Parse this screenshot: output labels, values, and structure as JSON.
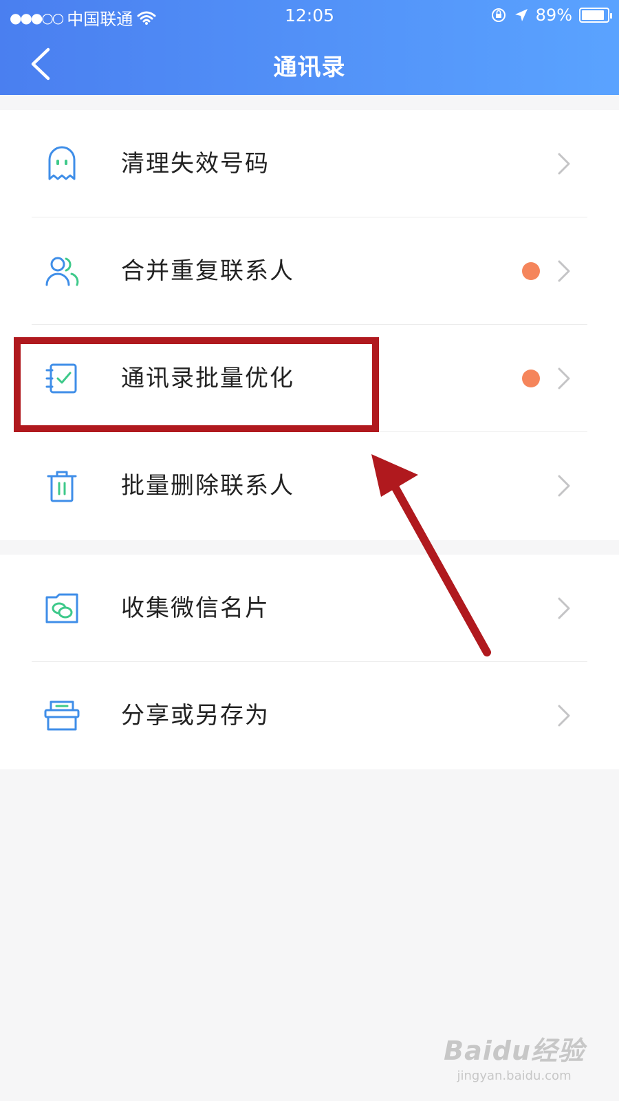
{
  "status_bar": {
    "signal": "●●●○○",
    "carrier": "中国联通",
    "time": "12:05",
    "battery": "89%",
    "battery_level": 0.89
  },
  "navbar": {
    "title": "通讯录"
  },
  "colors": {
    "header_start": "#4a7ff0",
    "header_end": "#5aa3ff",
    "icon_blue": "#3f8ee8",
    "icon_green": "#3ec98a",
    "badge_orange": "#f5855b",
    "highlight_red": "#b0191e"
  },
  "menu_group_1": [
    {
      "label": "清理失效号码",
      "icon": "ghost-icon",
      "badge": false
    },
    {
      "label": "合并重复联系人",
      "icon": "contacts-icon",
      "badge": true
    },
    {
      "label": "通讯录批量优化",
      "icon": "checklist-icon",
      "badge": true
    },
    {
      "label": "批量删除联系人",
      "icon": "trash-icon",
      "badge": false
    }
  ],
  "menu_group_2": [
    {
      "label": "收集微信名片",
      "icon": "wechat-card-icon",
      "badge": false
    },
    {
      "label": "分享或另存为",
      "icon": "share-box-icon",
      "badge": false
    }
  ],
  "watermark": {
    "main": "Baidu经验",
    "sub": "jingyan.baidu.com"
  }
}
